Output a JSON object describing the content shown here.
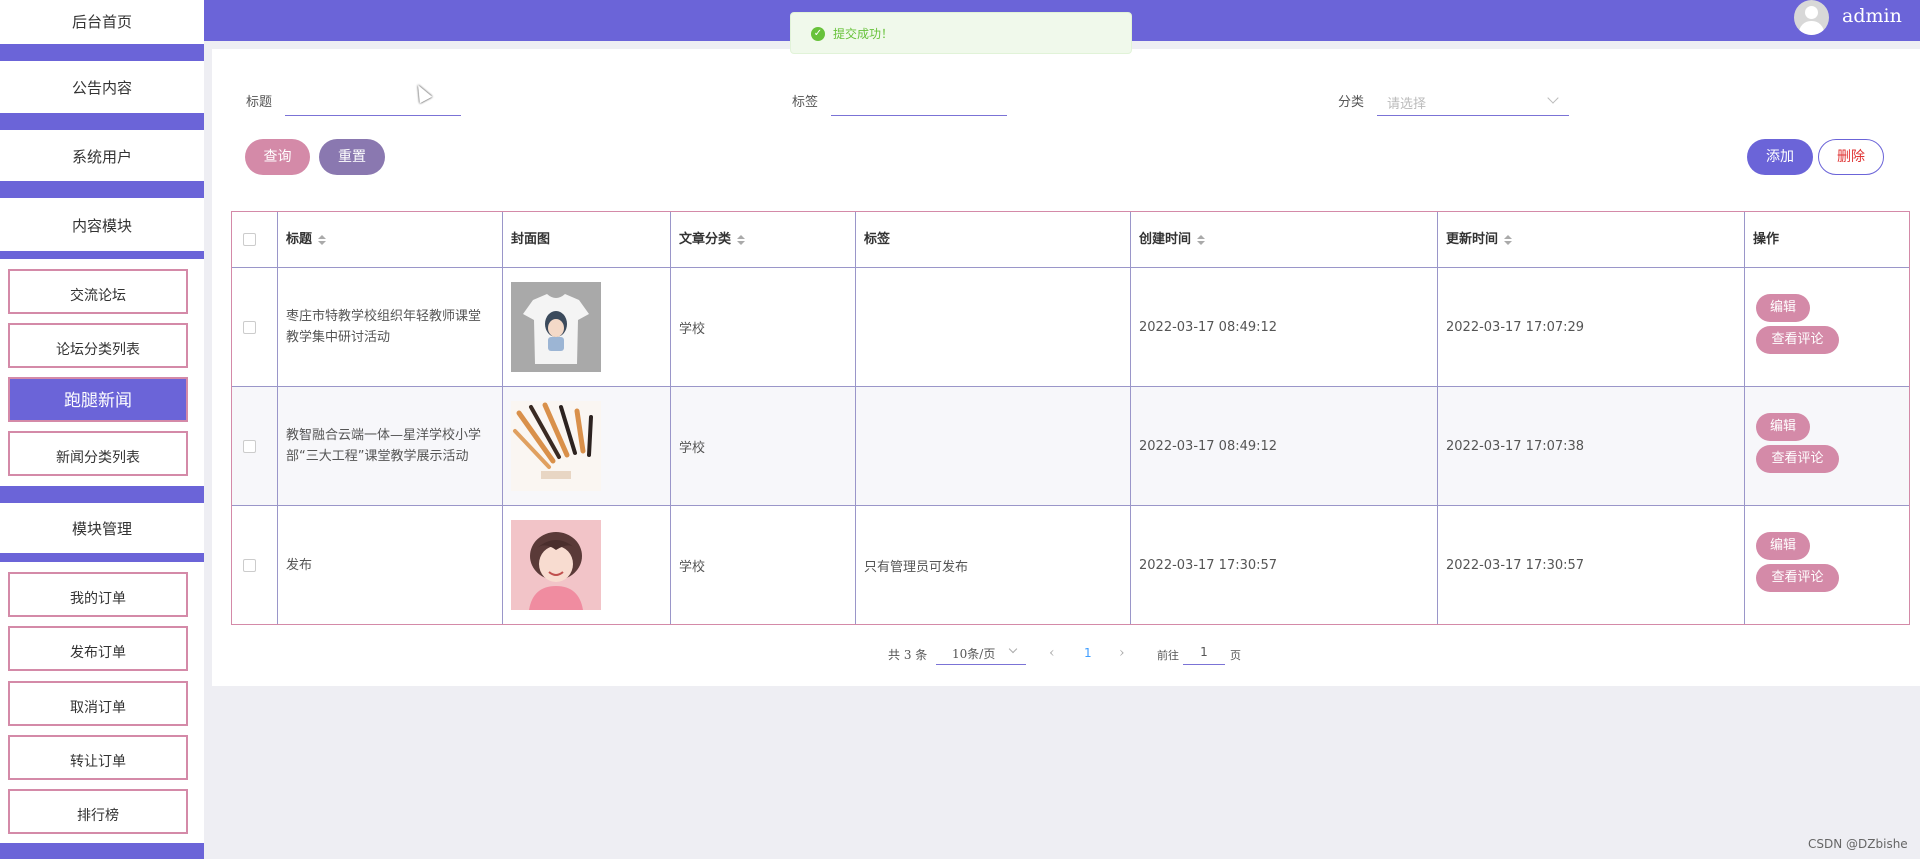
{
  "sidebar": {
    "top_items": [
      {
        "label": "后台首页"
      },
      {
        "label": "公告内容"
      },
      {
        "label": "系统用户"
      },
      {
        "label": "内容模块"
      }
    ],
    "content_sub_items": [
      {
        "label": "交流论坛"
      },
      {
        "label": "论坛分类列表"
      },
      {
        "label": "跑腿新闻"
      },
      {
        "label": "新闻分类列表"
      }
    ],
    "module_group": {
      "label": "模块管理"
    },
    "module_sub_items": [
      {
        "label": "我的订单"
      },
      {
        "label": "发布订单"
      },
      {
        "label": "取消订单"
      },
      {
        "label": "转让订单"
      },
      {
        "label": "排行榜"
      }
    ],
    "active_label": "跑腿新闻"
  },
  "header": {
    "username": "admin"
  },
  "toast": {
    "message": "提交成功！",
    "type": "success"
  },
  "filters": {
    "title_label": "标题",
    "title_value": "",
    "tag_label": "标签",
    "tag_value": "",
    "category_label": "分类",
    "category_placeholder": "请选择"
  },
  "buttons": {
    "search": "查询",
    "reset": "重置",
    "add": "添加",
    "delete": "删除"
  },
  "table": {
    "columns": [
      "标题",
      "封面图",
      "文章分类",
      "标签",
      "创建时间",
      "更新时间",
      "操作"
    ],
    "rows": [
      {
        "title": "枣庄市特教学校组织年轻教师课堂教学集中研讨活动",
        "cover": "t-shirt-image",
        "category": "学校",
        "tag": "",
        "created": "2022-03-17 08:49:12",
        "updated": "2022-03-17 17:07:29"
      },
      {
        "title": "教智融合云端一体—星洋学校小学部“三大工程”课堂教学展示活动",
        "cover": "makeup-brushes-image",
        "category": "学校",
        "tag": "",
        "created": "2022-03-17 08:49:12",
        "updated": "2022-03-17 17:07:38"
      },
      {
        "title": "发布",
        "cover": "anime-boy-image",
        "category": "学校",
        "tag": "只有管理员可发布",
        "created": "2022-03-17 17:30:57",
        "updated": "2022-03-17 17:30:57"
      }
    ],
    "row_actions": {
      "edit": "编辑",
      "comments": "查看评论"
    }
  },
  "pagination": {
    "total": "共 3 条",
    "page_size": "10条/页",
    "current_page": "1",
    "goto_label": "前往",
    "goto_value": "1",
    "page_suffix": "页"
  },
  "watermark": "CSDN @DZbishe",
  "colors": {
    "primary": "#6b64d8",
    "pink": "#d48aa8",
    "reset": "#8a78b0",
    "success": "#67c23a"
  }
}
